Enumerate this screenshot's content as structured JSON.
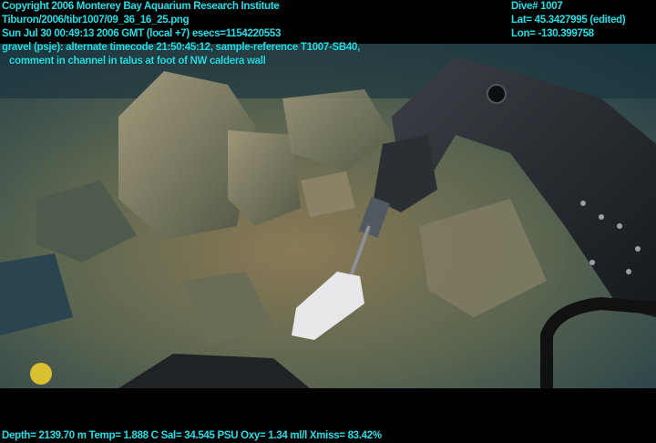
{
  "header_left": {
    "copyright": "Copyright 2006 Monterey Bay Aquarium Research Institute",
    "file": "Tiburon/2006/tibr1007/09_36_16_25.png",
    "datetime": "Sun Jul 30 00:49:13 2006 GMT (local +7)  esecs=1154220553",
    "comment_1": "gravel (psje): alternate timecode 21:50:45:12, sample-reference T1007-SB40,",
    "comment_2": "comment in channel in talus at foot of NW caldera wall"
  },
  "header_right": {
    "dive": "Dive# 1007",
    "lat": "Lat= 45.3427995 (edited)",
    "lon": "Lon= -130.399758"
  },
  "footer": {
    "sensors": "Depth= 2139.70 m  Temp= 1.888 C  Sal= 34.545 PSU  Oxy= 1.34 ml/l  Xmiss= 83.42%"
  },
  "colors": {
    "overlay_text": "#1fe0e8"
  }
}
